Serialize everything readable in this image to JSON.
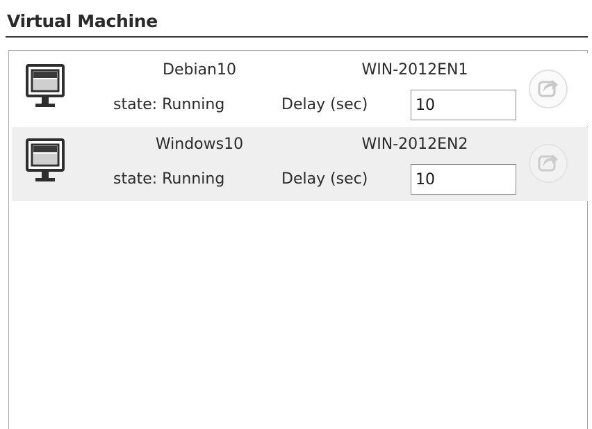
{
  "panel": {
    "title": "Virtual Machine"
  },
  "vms": [
    {
      "name": "Debian10",
      "host": "WIN-2012EN1",
      "state": "state: Running",
      "delay_label": "Delay (sec)",
      "delay_value": "10",
      "icon": "monitor-icon",
      "action_icon": "connect-share-icon"
    },
    {
      "name": "Windows10",
      "host": "WIN-2012EN2",
      "state": "state: Running",
      "delay_label": "Delay (sec)",
      "delay_value": "10",
      "icon": "monitor-icon",
      "action_icon": "connect-share-icon"
    }
  ],
  "colors": {
    "row_alt_background": "#efefef",
    "header_rule": "#3a3a3a",
    "list_border": "#a9a9a9",
    "disabled_icon": "#c8c8c8"
  }
}
